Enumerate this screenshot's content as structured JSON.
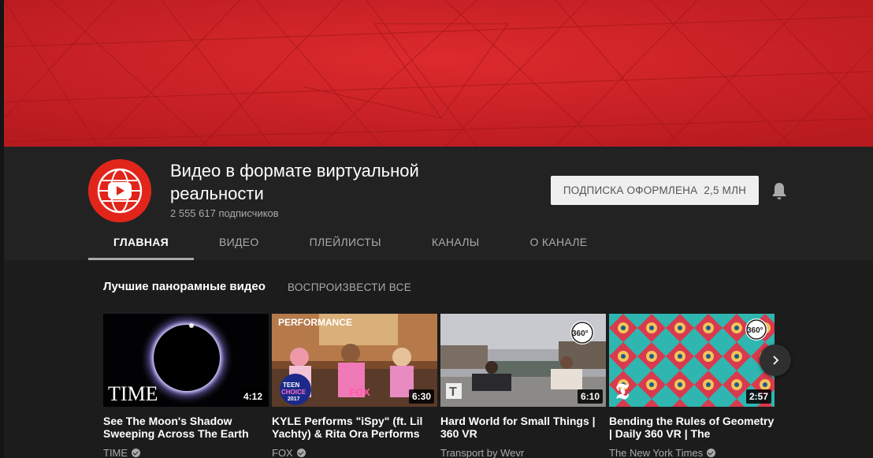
{
  "channel": {
    "title": "Видео в формате виртуальной реальности",
    "subscribers_text": "2 555 617 подписчиков",
    "subscribe_label": "ПОДПИСКА ОФОРМЛЕНА",
    "subscribe_count": "2,5 МЛН",
    "avatar_icon": "youtube-globe-icon",
    "brand_color": "#e1251b"
  },
  "tabs": [
    {
      "label": "ГЛАВНАЯ",
      "active": true
    },
    {
      "label": "ВИДЕО",
      "active": false
    },
    {
      "label": "ПЛЕЙЛИСТЫ",
      "active": false
    },
    {
      "label": "КАНАЛЫ",
      "active": false
    },
    {
      "label": "О КАНАЛЕ",
      "active": false
    }
  ],
  "shelf": {
    "title": "Лучшие панорамные видео",
    "play_all": "ВОСПРОИЗВЕСТИ ВСЕ",
    "videos": [
      {
        "title": "See The Moon's Shadow Sweeping Across The Earth",
        "channel": "TIME",
        "duration": "4:12",
        "thumb_logo": "TIME",
        "verified": true
      },
      {
        "title": "KYLE Performs \"iSpy\" (ft. Lil Yachty) & Rita Ora Performs",
        "channel": "FOX",
        "duration": "6:30",
        "thumb_label": "PERFORMANCE",
        "thumb_badge": "TEEN CHOICE 2017",
        "thumb_network": "FOX",
        "verified": true
      },
      {
        "title": "Hard World for Small Things | 360 VR",
        "channel": "Transport by Wevr",
        "duration": "6:10",
        "thumb_badge": "360°",
        "thumb_logo": "T",
        "verified": false
      },
      {
        "title": "Bending the Rules of Geometry | Daily 360 VR | The",
        "channel": "The New York Times",
        "duration": "2:57",
        "thumb_badge": "360°",
        "verified": true
      }
    ]
  },
  "icons": {
    "bell": "bell-icon",
    "next": "chevron-right-icon",
    "verified": "verified-check-icon"
  }
}
